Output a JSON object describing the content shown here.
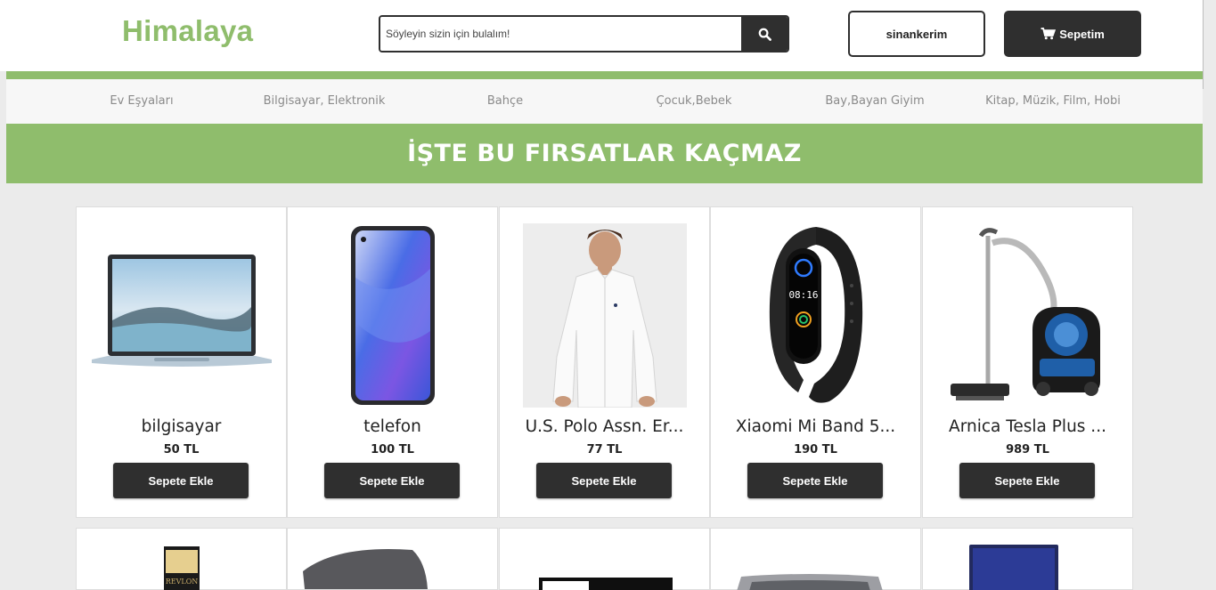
{
  "header": {
    "logo": "Himalaya",
    "search_placeholder": "Söyleyin sizin için bulalım!",
    "user_label": "sinankerim",
    "cart_label": "Sepetim"
  },
  "nav": {
    "items": [
      {
        "label": "Ev Eşyaları"
      },
      {
        "label": "Bilgisayar, Elektronik"
      },
      {
        "label": "Bahçe"
      },
      {
        "label": "Çocuk,Bebek"
      },
      {
        "label": "Bay,Bayan Giyim"
      },
      {
        "label": "Kitap, Müzik, Film, Hobi"
      }
    ]
  },
  "banner": {
    "title": "İŞTE BU FIRSATLAR KAÇMAZ"
  },
  "products": [
    {
      "name": "bilgisayar",
      "price": "50 TL",
      "button": "Sepete Ekle",
      "icon": "laptop-image"
    },
    {
      "name": "telefon",
      "price": "100 TL",
      "button": "Sepete Ekle",
      "icon": "phone-image"
    },
    {
      "name": "U.S. Polo Assn. Er...",
      "price": "77 TL",
      "button": "Sepete Ekle",
      "icon": "shirt-image"
    },
    {
      "name": "Xiaomi Mi Band 5...",
      "price": "190 TL",
      "button": "Sepete Ekle",
      "icon": "smartband-image"
    },
    {
      "name": "Arnica Tesla Plus ...",
      "price": "989 TL",
      "button": "Sepete Ekle",
      "icon": "vacuum-image"
    }
  ],
  "product_image_text": {
    "watch_time": "08:16",
    "perfume_brand": "REVLON"
  },
  "colors": {
    "accent": "#8fbd6c",
    "dark": "#2f2f2f"
  }
}
